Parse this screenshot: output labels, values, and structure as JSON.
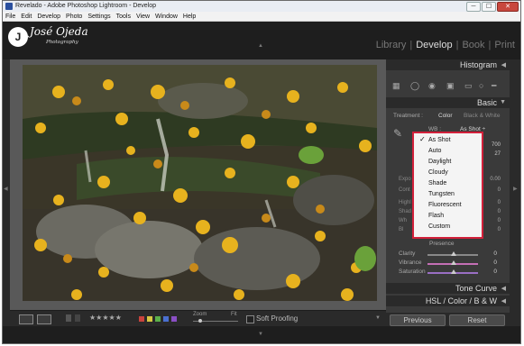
{
  "window": {
    "title": "Revelado - Adobe Photoshop Lightroom - Develop",
    "buttons": [
      "─",
      "☐",
      "✕"
    ]
  },
  "menu": [
    "File",
    "Edit",
    "Develop",
    "Photo",
    "Settings",
    "Tools",
    "View",
    "Window",
    "Help"
  ],
  "identity_plate": {
    "monogram": "J",
    "name": "José Ojeda",
    "subtitle": "Photography"
  },
  "modules": {
    "items": [
      "Library",
      "Develop",
      "Book",
      "Print"
    ],
    "separator": "|",
    "active": "Develop"
  },
  "right_panel": {
    "histogram_title": "Histogram",
    "basic_title": "Basic",
    "treatment_label": "Treatment :",
    "treatment_color": "Color",
    "treatment_bw": "Black & White",
    "wb_label": "WB :",
    "wb_value": "As Shot ÷",
    "temp_value": "700",
    "tint_value": "27",
    "background_rows": [
      {
        "name": "Expo",
        "value": "0.00"
      },
      {
        "name": "Cont",
        "value": "0"
      },
      {
        "name": "Highl",
        "value": "0"
      },
      {
        "name": "Shad",
        "value": "0"
      },
      {
        "name": "Wh",
        "value": "0"
      },
      {
        "name": "Bl",
        "value": "0"
      }
    ],
    "presence_label": "Presence",
    "presence_sliders": [
      {
        "name": "Clarity",
        "value": "0",
        "color": "#888888"
      },
      {
        "name": "Vibrance",
        "value": "0",
        "color": "#c46fb5"
      },
      {
        "name": "Saturation",
        "value": "0",
        "color": "#9a6fc4"
      }
    ],
    "tone_curve_title": "Tone Curve",
    "hsl_title": "HSL / Color / B & W",
    "previous_button": "Previous",
    "reset_button": "Reset"
  },
  "wb_dropdown": {
    "options": [
      "As Shot",
      "Auto",
      "Daylight",
      "Cloudy",
      "Shade",
      "Tungsten",
      "Fluorescent",
      "Flash",
      "Custom"
    ],
    "selected": "As Shot",
    "border_color": "#d2203a"
  },
  "toolbar": {
    "stars": "★★★★★",
    "color_labels": [
      "#c8433d",
      "#d8c743",
      "#5bb04a",
      "#4a6fd0",
      "#8a4fc4"
    ],
    "zoom_label": "Zoom",
    "fit_label": "Fit",
    "soft_proofing_label": "Soft Proofing"
  },
  "strip_arrows": {
    "top": "▲",
    "bottom": "▼",
    "left": "◀",
    "right": "▶",
    "toolbar_dropdown": "▼"
  }
}
